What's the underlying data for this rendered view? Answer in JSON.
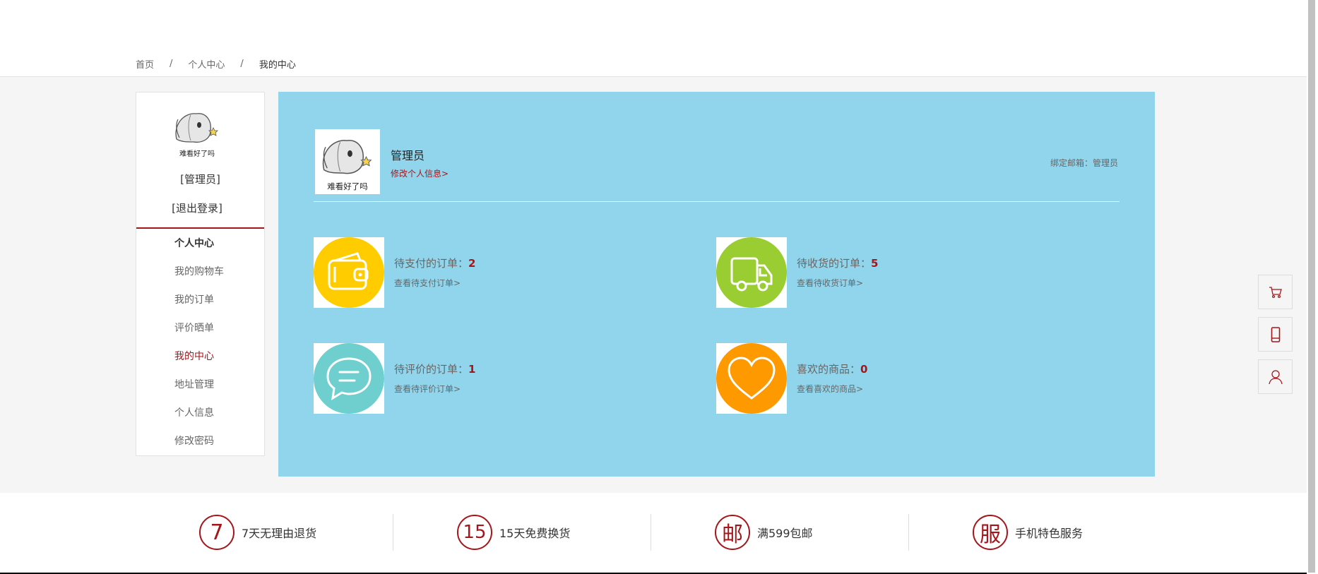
{
  "breadcrumb": {
    "home": "首页",
    "center": "个人中心",
    "current": "我的中心",
    "separator": "/"
  },
  "sidebar": {
    "avatar_icon": "hamster-avatar",
    "avatar_caption": "难看好了吗",
    "username": "[管理员]",
    "logout": "[退出登录]",
    "items": [
      {
        "label": "个人中心",
        "state": "heading"
      },
      {
        "label": "我的购物车",
        "state": "normal"
      },
      {
        "label": "我的订单",
        "state": "normal"
      },
      {
        "label": "评价晒单",
        "state": "normal"
      },
      {
        "label": "我的中心",
        "state": "active"
      },
      {
        "label": "地址管理",
        "state": "normal"
      },
      {
        "label": "个人信息",
        "state": "normal"
      },
      {
        "label": "修改密码",
        "state": "normal"
      }
    ]
  },
  "profile": {
    "name": "管理员",
    "edit_link": "修改个人信息>",
    "email_label": "绑定邮箱：",
    "email_value": "管理员"
  },
  "stats": [
    {
      "label": "待支付的订单：",
      "count": "2",
      "link": "查看待支付订单>",
      "icon": "wallet-icon",
      "color": "#ffcc00"
    },
    {
      "label": "待收货的订单：",
      "count": "5",
      "link": "查看待收货订单>",
      "icon": "truck-icon",
      "color": "#9acd32"
    },
    {
      "label": "待评价的订单：",
      "count": "1",
      "link": "查看待评价订单>",
      "icon": "chat-icon",
      "color": "#6fcfcf"
    },
    {
      "label": "喜欢的商品：",
      "count": "0",
      "link": "查看喜欢的商品>",
      "icon": "heart-icon",
      "color": "#ff9900"
    }
  ],
  "services": [
    {
      "glyph": "7",
      "text": "7天无理由退货"
    },
    {
      "glyph": "15",
      "text": "15天免费换货"
    },
    {
      "glyph": "邮",
      "text": "满599包邮"
    },
    {
      "glyph": "服",
      "text": "手机特色服务"
    }
  ],
  "tools": [
    "cart-icon",
    "phone-icon",
    "user-icon"
  ],
  "colors": {
    "accent": "#a4161a",
    "panel": "#91d5ec",
    "background": "#f5f5f5"
  }
}
